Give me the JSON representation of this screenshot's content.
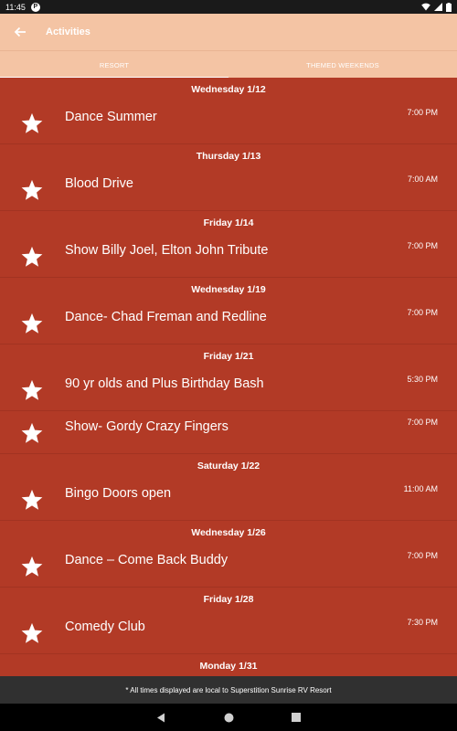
{
  "status_bar": {
    "time": "11:45",
    "app_icon_letter": "P"
  },
  "header": {
    "title": "Activities"
  },
  "tabs": [
    {
      "label": "RESORT",
      "active": true
    },
    {
      "label": "THEMED WEEKENDS",
      "active": false
    }
  ],
  "days": [
    {
      "header": "Wednesday 1/12",
      "events": [
        {
          "title": "Dance Summer",
          "time": "7:00 PM"
        }
      ]
    },
    {
      "header": "Thursday 1/13",
      "events": [
        {
          "title": "Blood Drive",
          "time": "7:00 AM"
        }
      ]
    },
    {
      "header": "Friday 1/14",
      "events": [
        {
          "title": "Show Billy Joel, Elton John Tribute",
          "time": "7:00 PM"
        }
      ]
    },
    {
      "header": "Wednesday 1/19",
      "events": [
        {
          "title": "Dance- Chad Freman and Redline",
          "time": "7:00 PM"
        }
      ]
    },
    {
      "header": "Friday 1/21",
      "events": [
        {
          "title": "90 yr olds and Plus Birthday Bash",
          "time": "5:30 PM"
        },
        {
          "title": "Show- Gordy Crazy Fingers",
          "time": "7:00 PM"
        }
      ]
    },
    {
      "header": "Saturday 1/22",
      "events": [
        {
          "title": "Bingo Doors open",
          "time": "11:00 AM"
        }
      ]
    },
    {
      "header": "Wednesday 1/26",
      "events": [
        {
          "title": "Dance – Come Back Buddy",
          "time": "7:00 PM"
        }
      ]
    },
    {
      "header": "Friday 1/28",
      "events": [
        {
          "title": "Comedy Club",
          "time": "7:30 PM"
        }
      ]
    },
    {
      "header": "Monday 1/31",
      "events": []
    }
  ],
  "footer": {
    "note": "* All times displayed are local to Superstition Sunrise RV Resort"
  },
  "icons": {
    "event_icon": "star-icon",
    "back": "arrow-left-icon"
  },
  "colors": {
    "list_background": "#b23a26",
    "appbar_background": "#f4c4a4",
    "footer_background": "#303030"
  }
}
